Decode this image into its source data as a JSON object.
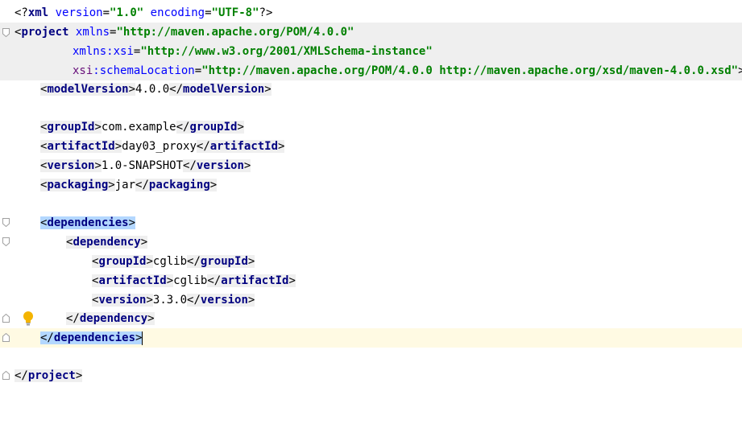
{
  "lines": {
    "l1": {
      "open": "<?",
      "name": "xml",
      "a1": "version",
      "v1": "\"1.0\"",
      "a2": "encoding",
      "v2": "\"UTF-8\"",
      "close": "?>"
    },
    "l2": {
      "open": "<",
      "name": "project",
      "attr": "xmlns",
      "val": "\"http://maven.apache.org/POM/4.0.0\""
    },
    "l3": {
      "ns": "xmlns",
      "colon": ":",
      "attr": "xsi",
      "val": "\"http://www.w3.org/2001/XMLSchema-instance\""
    },
    "l4": {
      "ns": "xsi",
      "colon": ":",
      "attr": "schemaLocation",
      "val": "\"http://maven.apache.org/POM/4.0.0 http://maven.apache.org/xsd/maven-4.0.0.xsd\"",
      "close": ">"
    },
    "l5": {
      "tag": "modelVersion",
      "text": "4.0.0"
    },
    "l7": {
      "tag": "groupId",
      "text": "com.example"
    },
    "l8": {
      "tag": "artifactId",
      "text": "day03_proxy"
    },
    "l9": {
      "tag": "version",
      "text": "1.0-SNAPSHOT"
    },
    "l10": {
      "tag": "packaging",
      "text": "jar"
    },
    "l12": {
      "tag": "dependencies"
    },
    "l13": {
      "tag": "dependency"
    },
    "l14": {
      "tag": "groupId",
      "text": "cglib"
    },
    "l15": {
      "tag": "artifactId",
      "text": "cglib"
    },
    "l16": {
      "tag": "version",
      "text": "3.3.0"
    },
    "l17": {
      "tag": "dependency"
    },
    "l18": {
      "tag": "dependencies"
    },
    "l20": {
      "tag": "project"
    }
  },
  "symbols": {
    "lt": "<",
    "gt": ">",
    "lt_slash": "</",
    "eq": "="
  },
  "colors": {
    "tag": "#000080",
    "attribute": "#0000ff",
    "namespace": "#660e7a",
    "value": "#008000",
    "highlight": "#b3d7ff",
    "current_line": "#fffae3"
  },
  "icons": {
    "intention": "lightbulb-icon",
    "fold": "fold-marker-icon"
  }
}
